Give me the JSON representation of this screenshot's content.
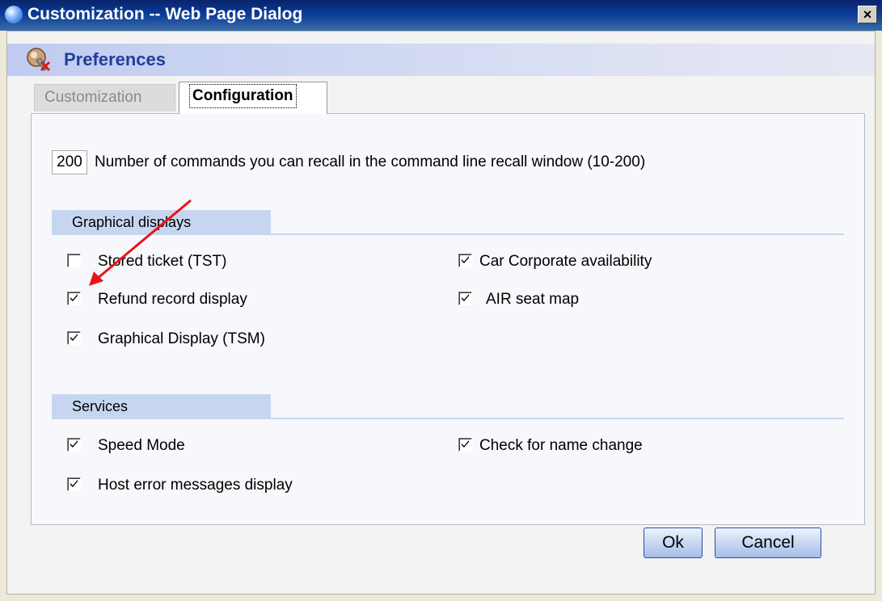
{
  "window": {
    "title": "Customization -- Web Page Dialog",
    "close_glyph": "×"
  },
  "header": {
    "title": "Preferences",
    "icon": "preferences-icon"
  },
  "tabs": [
    {
      "label": "Customization",
      "active": false
    },
    {
      "label": "Configuration",
      "active": true
    }
  ],
  "recall": {
    "value": "200",
    "label": "Number of commands you can recall in the command line recall window (10-200)"
  },
  "graphical_displays": {
    "heading": "Graphical displays",
    "options": [
      {
        "label": "Stored ticket (TST)",
        "checked": false
      },
      {
        "label": "Refund record display",
        "checked": true
      },
      {
        "label": "Graphical Display (TSM)",
        "checked": true
      },
      {
        "label": "Car Corporate availability",
        "checked": true
      },
      {
        "label": "AIR seat map",
        "checked": true
      }
    ]
  },
  "services": {
    "heading": "Services",
    "options": [
      {
        "label": "Speed Mode",
        "checked": true
      },
      {
        "label": "Host error messages display",
        "checked": true
      },
      {
        "label": "Check for name change",
        "checked": true
      }
    ]
  },
  "buttons": {
    "ok": "Ok",
    "cancel": "Cancel"
  },
  "colors": {
    "title_bar": "#0a246a",
    "header_text": "#213f9a",
    "section_bg": "#c7d6f0",
    "annotation_arrow": "#e8141a"
  }
}
